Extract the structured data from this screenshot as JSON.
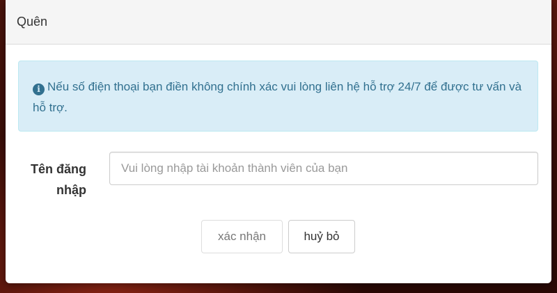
{
  "modal": {
    "title": "Quên"
  },
  "alert": {
    "icon": "info-circle-icon",
    "message": "Nếu số điện thoại bạn điền không chính xác vui lòng liên hệ hỗ trợ 24/7 để được tư vấn và hỗ trợ."
  },
  "form": {
    "username_label": "Tên đăng nhập",
    "username_value": "",
    "username_placeholder": "Vui lòng nhập tài khoản thành viên của bạn"
  },
  "buttons": {
    "confirm_label": "xác nhận",
    "cancel_label": "huỷ bỏ"
  },
  "colors": {
    "alert_background": "#d9edf7",
    "alert_text": "#31708f",
    "header_background": "#f5f5f5"
  }
}
